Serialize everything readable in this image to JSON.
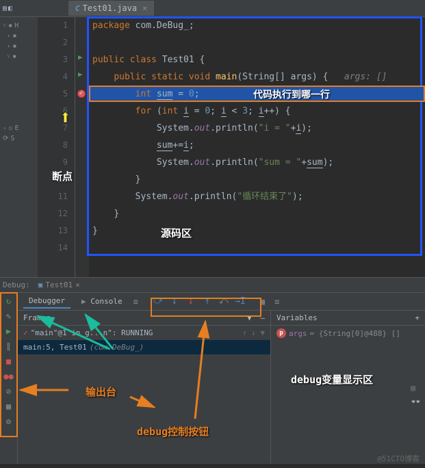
{
  "tab": {
    "filename": "Test01.java"
  },
  "tree": {
    "items": [
      "H",
      "(",
      "(",
      "H",
      "E",
      "S"
    ]
  },
  "code": {
    "lines": [
      1,
      2,
      3,
      4,
      5,
      6,
      7,
      8,
      9,
      10,
      11,
      12,
      13,
      14
    ],
    "l1": {
      "pkg": "package",
      "name": " com.DeBug_;"
    },
    "l3": {
      "pub": "public class ",
      "cls": "Test01",
      "brace": " {"
    },
    "l4": {
      "psv": "public static void ",
      "main": "main",
      "args1": "(String[] args) {",
      "hint": "   args: []"
    },
    "l5": {
      "int": "int ",
      "sum": "sum",
      "eq": " = ",
      "z": "0",
      "sc": ";"
    },
    "l6": {
      "for": "for ",
      "p1": "(",
      "int": "int ",
      "i": "i",
      "eq": " = ",
      "z": "0",
      "sc1": "; ",
      "i2": "i",
      "lt": " < ",
      "three": "3",
      "sc2": "; ",
      "i3": "i",
      "pp": "++) {"
    },
    "l7": {
      "sys": "System.",
      "out": "out",
      "p": ".println(",
      "str": "\"i = \"",
      "plus": "+",
      "i": "i",
      "cp": ");"
    },
    "l8": {
      "sum": "sum",
      "pe": "+=",
      "i": "i",
      "sc": ";"
    },
    "l9": {
      "sys": "System.",
      "out": "out",
      "p": ".println(",
      "str": "\"sum = \"",
      "plus": "+",
      "sum": "sum",
      "cp": ");"
    },
    "l10": {
      "brace": "}"
    },
    "l11": {
      "sys": "System.",
      "out": "out",
      "p": ".println(",
      "str": "\"循环结束了\"",
      "cp": ");"
    },
    "l12": {
      "brace": "}"
    },
    "l13": {
      "brace": "}"
    }
  },
  "debug": {
    "title": "Debug:",
    "run_config": "Test01",
    "tabs": {
      "debugger": "Debugger",
      "console": "Console"
    },
    "panels": {
      "frames": "Frames",
      "vars": "Variables"
    },
    "frame1": "\"main\"@1 in g...n\": RUNNING",
    "frame2_a": "main:5, Test01 ",
    "frame2_b": "(com.DeBug_)",
    "var1_name": "args",
    "var1_val": " = {String[0]@488} []"
  },
  "annotations": {
    "exec_line": "代码执行到哪一行",
    "source_area": "源码区",
    "breakpoint": "断点",
    "output": "输出台",
    "debug_ctrl": "debug控制按钮",
    "debug_vars": "debug变量显示区"
  },
  "watermark": "@51CTO博客"
}
